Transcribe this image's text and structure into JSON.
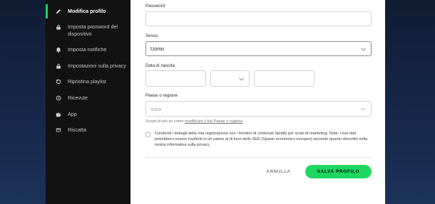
{
  "sidebar": {
    "items": [
      {
        "label": "Modifica profilo",
        "icon": "pencil-icon"
      },
      {
        "label": "Imposta password del dispositivo",
        "icon": "lock-icon"
      },
      {
        "label": "Imposta notifiche",
        "icon": "bell-icon"
      },
      {
        "label": "Impostazioni sulla privacy",
        "icon": "lock-icon"
      },
      {
        "label": "Ripristina playlist",
        "icon": "restore-icon"
      },
      {
        "label": "Ricevute",
        "icon": "clock-icon"
      },
      {
        "label": "App",
        "icon": "puzzle-icon"
      },
      {
        "label": "Riscatta",
        "icon": "card-icon"
      }
    ],
    "active_index": 0,
    "accent_color": "#1ed760"
  },
  "form": {
    "password": {
      "label": "Password",
      "value": ""
    },
    "sex": {
      "label": "Sesso",
      "value": "Uomo"
    },
    "birthdate": {
      "label": "Data di nascita",
      "day": "",
      "month": "",
      "year": ""
    },
    "country": {
      "label": "Paese o regione",
      "value": "Italia",
      "hint_prefix": "Scopri di più su come ",
      "hint_link": "modificare il tuo Paese o regione",
      "hint_suffix": "."
    },
    "consent": {
      "checked": false,
      "text": "Condividi i dettagli della mia registrazione con i fornitori di contenuti Spotify per scopi di marketing. Nota: i tuoi dati potrebbero essere trasferiti in un paese al di fuori dello SEE (Spazio economico europeo) secondo quanto descritto nella nostra informativa sulla privacy."
    },
    "cancel_label": "ANNULLA",
    "save_label": "SALVA PROFILO"
  }
}
